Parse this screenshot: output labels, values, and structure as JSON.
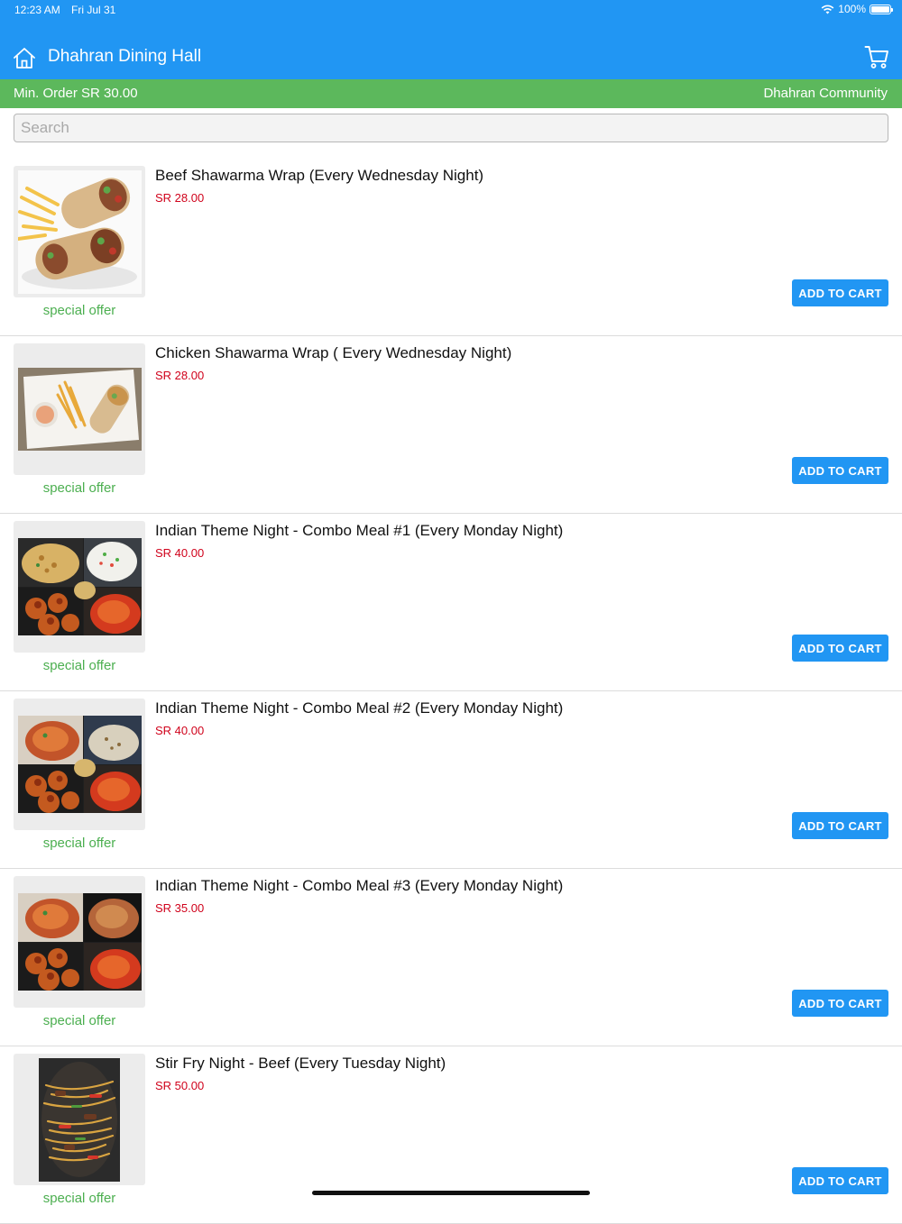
{
  "status_bar": {
    "time": "12:23 AM",
    "date": "Fri Jul 31",
    "battery": "100%"
  },
  "header": {
    "title": "Dhahran Dining Hall"
  },
  "info_bar": {
    "min_order": "Min. Order SR 30.00",
    "community": "Dhahran Community"
  },
  "search": {
    "placeholder": "Search",
    "value": ""
  },
  "items": [
    {
      "title": "Beef Shawarma Wrap (Every Wednesday Night)",
      "price": "SR 28.00",
      "badge": "special offer",
      "button": "ADD TO CART"
    },
    {
      "title": "Chicken Shawarma Wrap ( Every Wednesday Night)",
      "price": "SR 28.00",
      "badge": "special offer",
      "button": "ADD TO CART"
    },
    {
      "title": "Indian Theme Night - Combo Meal #1  (Every Monday Night)",
      "price": "SR 40.00",
      "badge": "special offer",
      "button": "ADD TO CART"
    },
    {
      "title": "Indian Theme Night - Combo Meal #2  (Every Monday Night)",
      "price": "SR 40.00",
      "badge": "special offer",
      "button": "ADD TO CART"
    },
    {
      "title": "Indian Theme Night - Combo Meal #3  (Every Monday Night)",
      "price": "SR 35.00",
      "badge": "special offer",
      "button": "ADD TO CART"
    },
    {
      "title": "Stir Fry Night - Beef (Every Tuesday Night)",
      "price": "SR 50.00",
      "badge": "special offer",
      "button": "ADD TO CART"
    }
  ],
  "colors": {
    "header": "#2196f3",
    "info_bar": "#5cb85c",
    "price": "#d0021b",
    "badge": "#4caf50",
    "button": "#2196f3"
  },
  "icons": {
    "home": "home-icon",
    "cart": "cart-icon",
    "wifi": "wifi-icon",
    "battery": "battery-icon"
  }
}
